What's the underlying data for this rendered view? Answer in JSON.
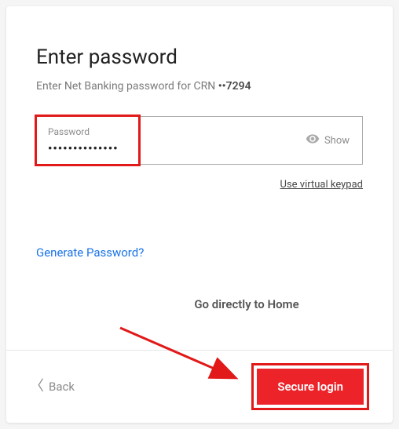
{
  "title": "Enter password",
  "subtitle_prefix": "Enter Net Banking password for CRN ",
  "crn_masked": "••7294",
  "password_field": {
    "label": "Password",
    "value": "••••••••••••••"
  },
  "show_label": "Show",
  "virtual_keypad": "Use virtual keypad",
  "generate_password": "Generate Password?",
  "go_home": "Go directly to Home",
  "back_label": "Back",
  "secure_login": "Secure login"
}
